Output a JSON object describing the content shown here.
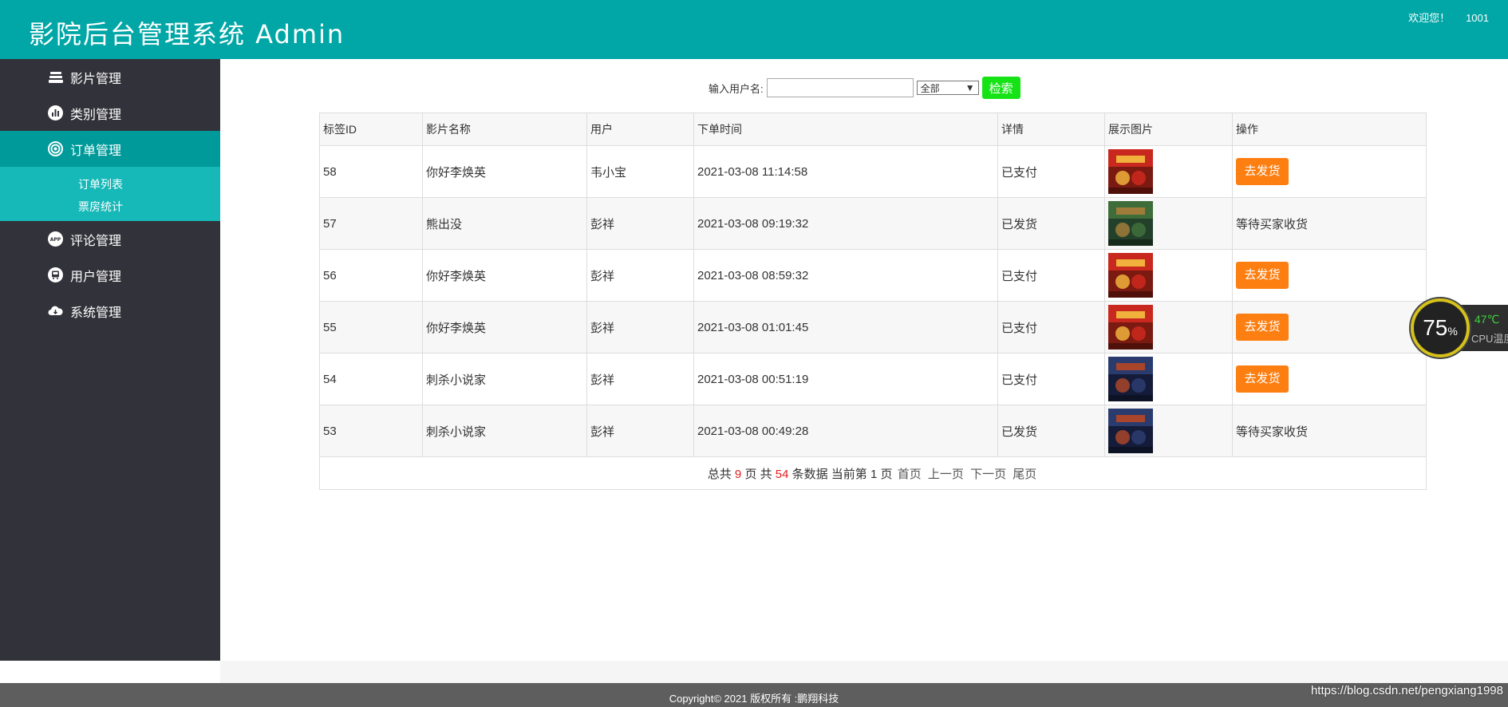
{
  "header": {
    "title": "影院后台管理系统 Admin",
    "welcome": "欢迎您！",
    "user_id": "1001"
  },
  "sidebar": {
    "items": [
      {
        "label": "影片管理",
        "icon": "film-stack-icon"
      },
      {
        "label": "类别管理",
        "icon": "chart-icon"
      },
      {
        "label": "订单管理",
        "icon": "target-icon"
      },
      {
        "label": "评论管理",
        "icon": "app-icon"
      },
      {
        "label": "用户管理",
        "icon": "bus-icon"
      },
      {
        "label": "系统管理",
        "icon": "cloud-icon"
      }
    ],
    "submenu": [
      {
        "label": "订单列表"
      },
      {
        "label": "票房统计"
      }
    ]
  },
  "search": {
    "label": "输入用户名:",
    "value": "",
    "select_value": "全部",
    "button": "检索"
  },
  "table": {
    "headers": [
      "标签ID",
      "影片名称",
      "用户",
      "下单时间",
      "详情",
      "展示图片",
      "操作"
    ],
    "rows": [
      {
        "id": "58",
        "film": "你好李焕英",
        "user": "韦小宝",
        "time": "2021-03-08 11:14:58",
        "status": "已支付",
        "poster": "red",
        "action": "去发货",
        "action_type": "button"
      },
      {
        "id": "57",
        "film": "熊出没",
        "user": "彭祥",
        "time": "2021-03-08 09:19:32",
        "status": "已发货",
        "poster": "green",
        "action": "等待买家收货",
        "action_type": "text"
      },
      {
        "id": "56",
        "film": "你好李焕英",
        "user": "彭祥",
        "time": "2021-03-08 08:59:32",
        "status": "已支付",
        "poster": "red",
        "action": "去发货",
        "action_type": "button"
      },
      {
        "id": "55",
        "film": "你好李焕英",
        "user": "彭祥",
        "time": "2021-03-08 01:01:45",
        "status": "已支付",
        "poster": "red",
        "action": "去发货",
        "action_type": "button"
      },
      {
        "id": "54",
        "film": "刺杀小说家",
        "user": "彭祥",
        "time": "2021-03-08 00:51:19",
        "status": "已支付",
        "poster": "blue",
        "action": "去发货",
        "action_type": "button"
      },
      {
        "id": "53",
        "film": "刺杀小说家",
        "user": "彭祥",
        "time": "2021-03-08 00:49:28",
        "status": "已发货",
        "poster": "blue",
        "action": "等待买家收货",
        "action_type": "text"
      }
    ]
  },
  "pager": {
    "total_label": "总共",
    "total_pages": "9",
    "page_unit": "页 共",
    "total_records": "54",
    "records_unit": "条数据 当前第",
    "current_page": "1",
    "current_unit": "页",
    "first": "首页",
    "prev": "上一页",
    "next": "下一页",
    "last": "尾页"
  },
  "footer": {
    "copyright": "Copyright© 2021 版权所有 :鹏翔科技",
    "watermark": "https://blog.csdn.net/pengxiang1998"
  },
  "cpu_widget": {
    "percent": "75",
    "percent_sign": "%",
    "temp": "47℃",
    "label": "CPU温度"
  },
  "colors": {
    "header": "#01a6a6",
    "sidebar": "#32323a",
    "active": "#009a9a",
    "submenu": "#16b8b8",
    "search_button": "#16e316",
    "ship_button": "#fd7e11"
  }
}
